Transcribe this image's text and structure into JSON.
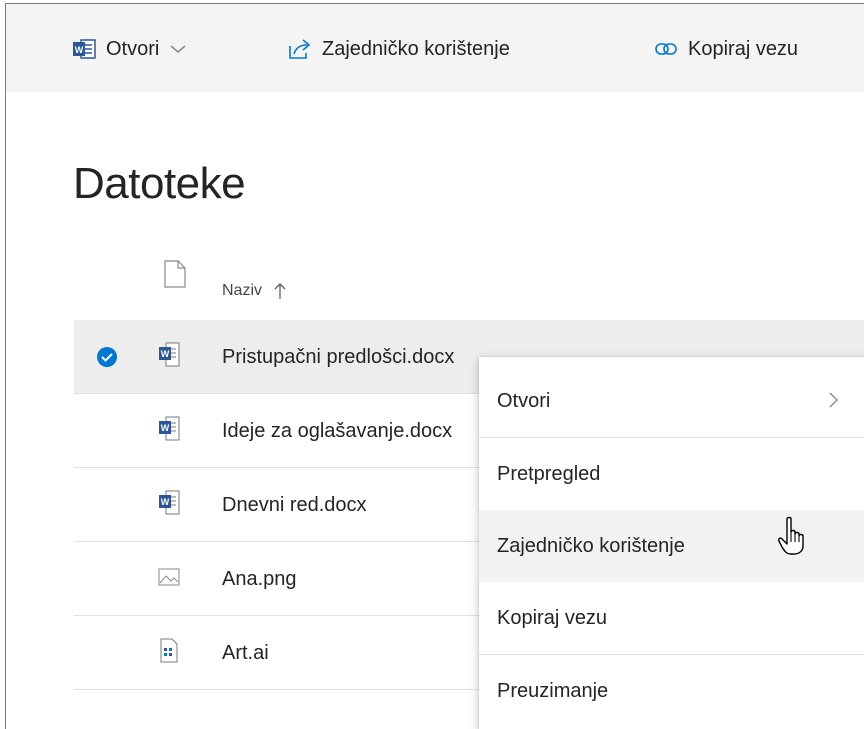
{
  "toolbar": {
    "open_label": "Otvori",
    "share_label": "Zajedničko korištenje",
    "copy_link_label": "Kopiraj vezu"
  },
  "page": {
    "title": "Datoteke"
  },
  "list": {
    "header_name": "Naziv",
    "sort_direction": "ascending",
    "files": [
      {
        "name": "Pristupačni predlošci.docx",
        "type": "word",
        "selected": true
      },
      {
        "name": "Ideje za oglašavanje.docx",
        "type": "word",
        "selected": false
      },
      {
        "name": "Dnevni red.docx",
        "type": "word",
        "selected": false
      },
      {
        "name": "Ana.png",
        "type": "image",
        "selected": false
      },
      {
        "name": "Art.ai",
        "type": "illustrator",
        "selected": false
      }
    ]
  },
  "context_menu": {
    "items": [
      {
        "label": "Otvori",
        "has_submenu": true
      },
      {
        "label": "Pretpregled",
        "has_submenu": false
      },
      {
        "label": "Zajedničko korištenje",
        "has_submenu": false,
        "hovered": true
      },
      {
        "label": "Kopiraj vezu",
        "has_submenu": false
      },
      {
        "label": "Preuzimanje",
        "has_submenu": false
      }
    ]
  },
  "colors": {
    "accent": "#0078d4",
    "word_blue": "#2b579a",
    "toolbar_bg": "#f4f4f4",
    "selected_row_bg": "#ededed",
    "menu_hover_bg": "#f3f2f1"
  },
  "icons": {
    "open": "word-icon",
    "share": "share-icon",
    "copy_link": "link-icon",
    "selected_check": "check-circle-icon",
    "cursor": "hand-pointer-icon"
  }
}
